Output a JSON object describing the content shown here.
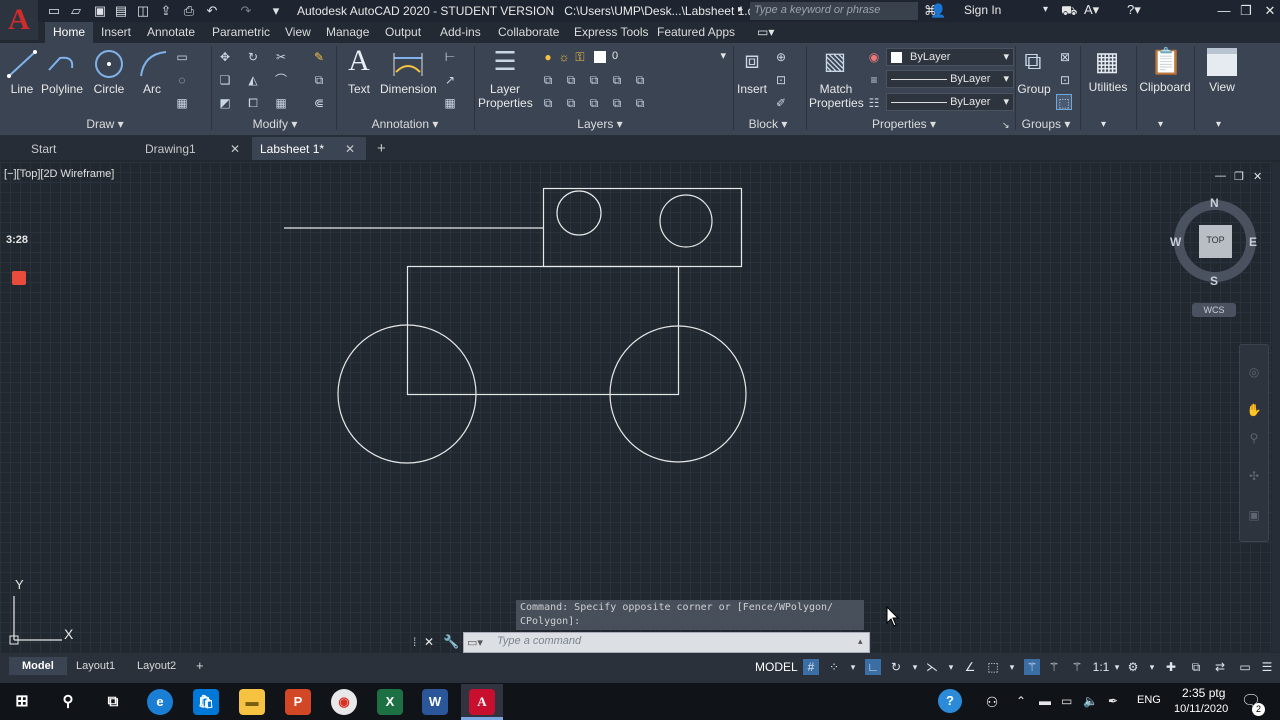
{
  "window": {
    "title": "Autodesk AutoCAD 2020 - STUDENT VERSION",
    "path": "C:\\Users\\UMP\\Desk...\\Labsheet 1.dwg",
    "search_placeholder": "Type a keyword or phrase",
    "sign_in": "Sign In"
  },
  "app_logo": "A",
  "ribbon_tabs": [
    "Home",
    "Insert",
    "Annotate",
    "Parametric",
    "View",
    "Manage",
    "Output",
    "Add-ins",
    "Collaborate",
    "Express Tools",
    "Featured Apps"
  ],
  "draw_panel": {
    "title": "Draw",
    "tools": [
      "Line",
      "Polyline",
      "Circle",
      "Arc"
    ]
  },
  "modify_panel": {
    "title": "Modify"
  },
  "annotation_panel": {
    "title": "Annotation",
    "tools": [
      "Text",
      "Dimension"
    ]
  },
  "layers_panel": {
    "title": "Layers",
    "layer_props": "Layer",
    "layer_props2": "Properties",
    "current_layer": "0"
  },
  "block_panel": {
    "title": "Block",
    "insert": "Insert"
  },
  "properties_panel": {
    "title": "Properties",
    "match": "Match",
    "match2": "Properties",
    "color": "ByLayer",
    "linetype": "ByLayer",
    "lineweight": "ByLayer"
  },
  "groups_panel": {
    "title": "Groups",
    "group": "Group"
  },
  "utilities": "Utilities",
  "clipboard": "Clipboard",
  "view": "View",
  "file_tabs": [
    "Start",
    "Drawing1",
    "Labsheet 1*"
  ],
  "viewport_label": "[−][Top][2D Wireframe]",
  "timer": "3:28",
  "viewcube": {
    "face": "TOP",
    "n": "N",
    "s": "S",
    "e": "E",
    "w": "W",
    "wcs": "WCS"
  },
  "ucs": {
    "x": "X",
    "y": "Y"
  },
  "command": {
    "history_line1": "Command: Specify opposite corner or [Fence/WPolygon/",
    "history_line2": "CPolygon]:",
    "placeholder": "Type a command"
  },
  "layout_tabs": [
    "Model",
    "Layout1",
    "Layout2"
  ],
  "status": {
    "model": "MODEL",
    "scale": "1:1"
  },
  "taskbar": {
    "time": "2:35 ptg",
    "date": "10/11/2020",
    "lang": "ENG",
    "notifications": "2"
  }
}
